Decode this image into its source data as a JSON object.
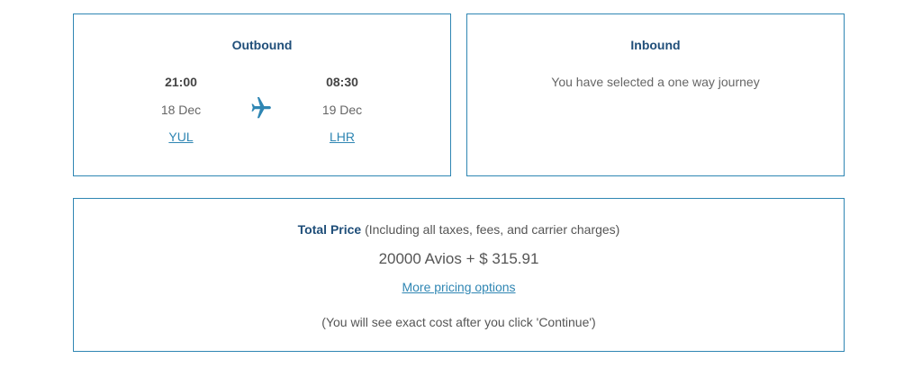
{
  "outbound": {
    "title": "Outbound",
    "departure": {
      "time": "21:00",
      "date": "18 Dec",
      "airport": "YUL"
    },
    "arrival": {
      "time": "08:30",
      "date": "19 Dec",
      "airport": "LHR"
    },
    "icon": "airplane-icon"
  },
  "inbound": {
    "title": "Inbound",
    "message": "You have selected a one way journey"
  },
  "price": {
    "label": "Total Price",
    "qualifier": "(Including all taxes, fees, and carrier charges)",
    "amount": "20000 Avios + $ 315.91",
    "more_options_link": "More pricing options",
    "note": "(You will see exact cost after you click 'Continue')"
  },
  "colors": {
    "border": "#2f86b3",
    "title": "#1f4e79",
    "link": "#2f86b3",
    "text": "#555555"
  }
}
